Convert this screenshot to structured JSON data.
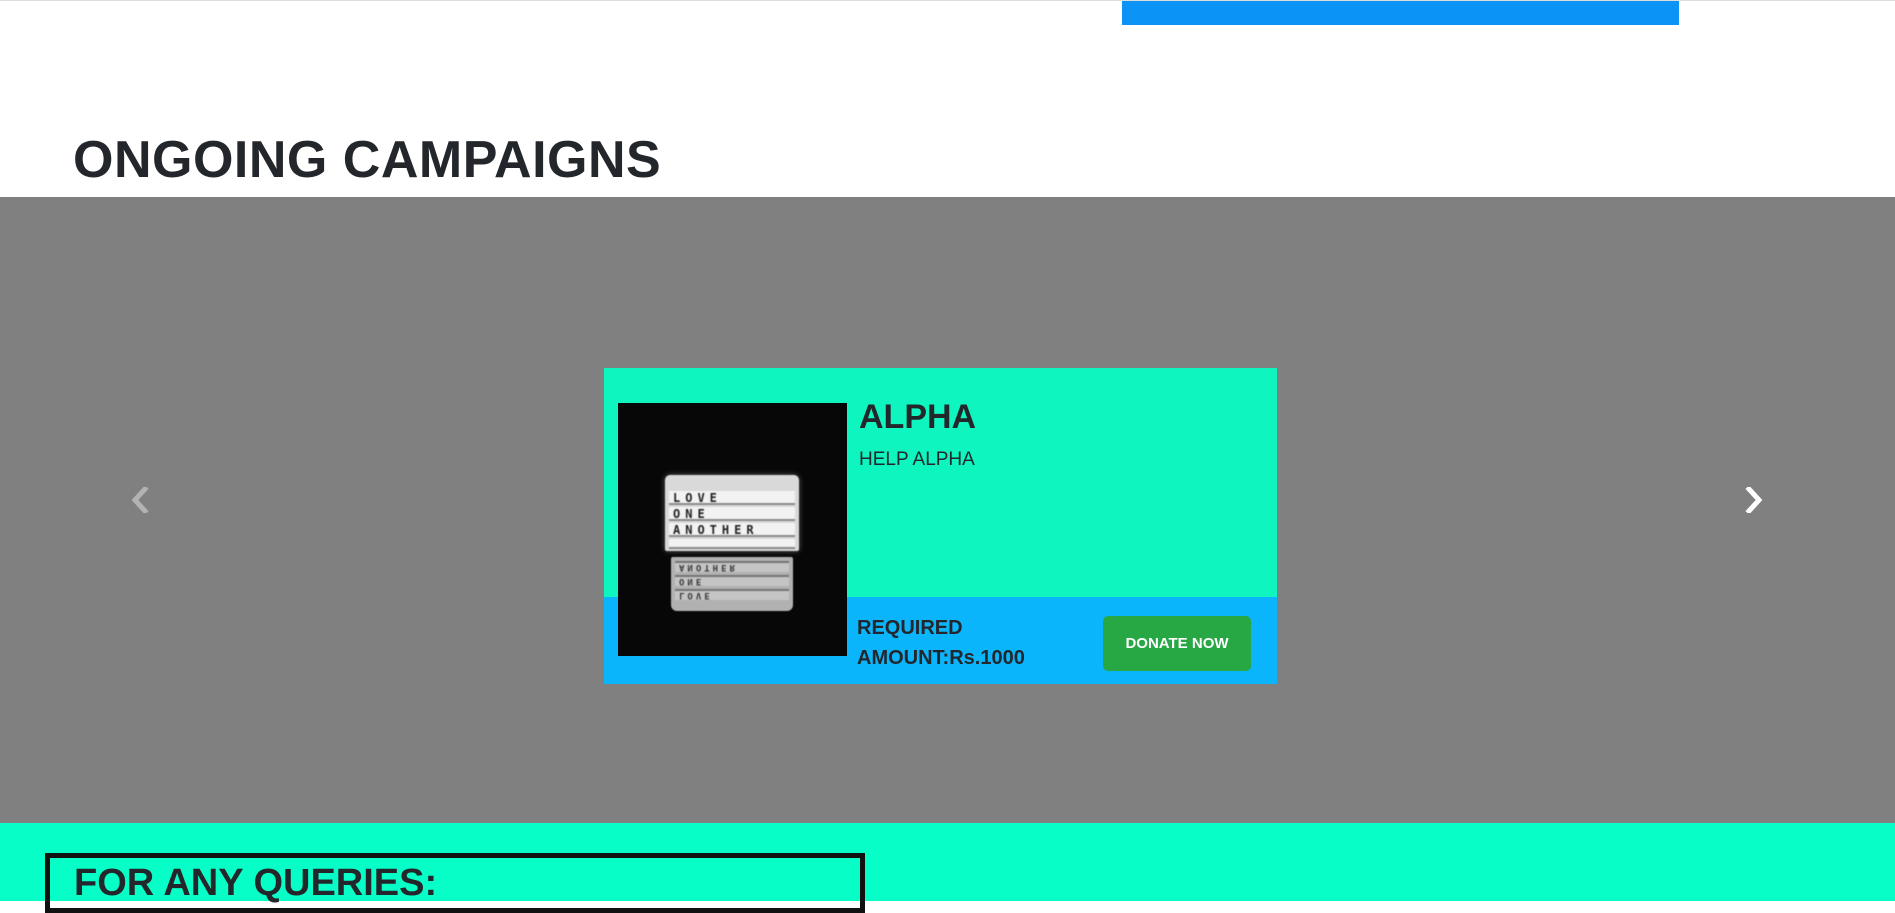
{
  "page": {
    "section_title": "ONGOING CAMPAIGNS"
  },
  "colors": {
    "top_bar": "#0b93f6",
    "carousel_bg": "#808080",
    "card_bg": "#0ef5c0",
    "card_footer_bg": "#0bb5fb",
    "donate_button": "#28a745",
    "footer_band": "#07ffc7"
  },
  "carousel": {
    "prev_icon": "chevron-left-icon",
    "next_icon": "chevron-right-icon",
    "active_slide": {
      "image": {
        "description_icon": "lightbox-sign-image",
        "sign_lines": [
          "LOVE",
          "ONE",
          "ANOTHER"
        ]
      },
      "title": "ALPHA",
      "subtitle": "HELP ALPHA",
      "required_amount": "REQUIRED AMOUNT:Rs.1000",
      "donate_label": "DONATE NOW"
    }
  },
  "footer": {
    "queries_title": "FOR ANY QUERIES:"
  }
}
